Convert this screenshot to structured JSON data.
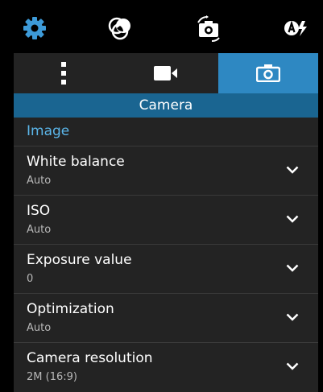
{
  "toolbar": {
    "icons": [
      "gear-icon",
      "color-effects-icon",
      "switch-camera-icon",
      "auto-flash-icon"
    ]
  },
  "tabs": {
    "items": [
      {
        "name": "more-options",
        "icon": "vertical-dots-icon",
        "active": false
      },
      {
        "name": "video",
        "icon": "video-camera-icon",
        "active": false
      },
      {
        "name": "camera",
        "icon": "photo-camera-icon",
        "active": true
      }
    ]
  },
  "panel": {
    "title": "Camera",
    "section_title": "Image",
    "settings": [
      {
        "label": "White balance",
        "value": "Auto"
      },
      {
        "label": "ISO",
        "value": "Auto"
      },
      {
        "label": "Exposure value",
        "value": "0"
      },
      {
        "label": "Optimization",
        "value": "Auto"
      },
      {
        "label": "Camera resolution",
        "value": "2M (16:9)"
      }
    ]
  },
  "colors": {
    "accent": "#2e88c2",
    "title_bar": "#1a6591",
    "section_text": "#5bb6ea",
    "gear": "#3d9ad8",
    "panel_bg": "#232323"
  }
}
